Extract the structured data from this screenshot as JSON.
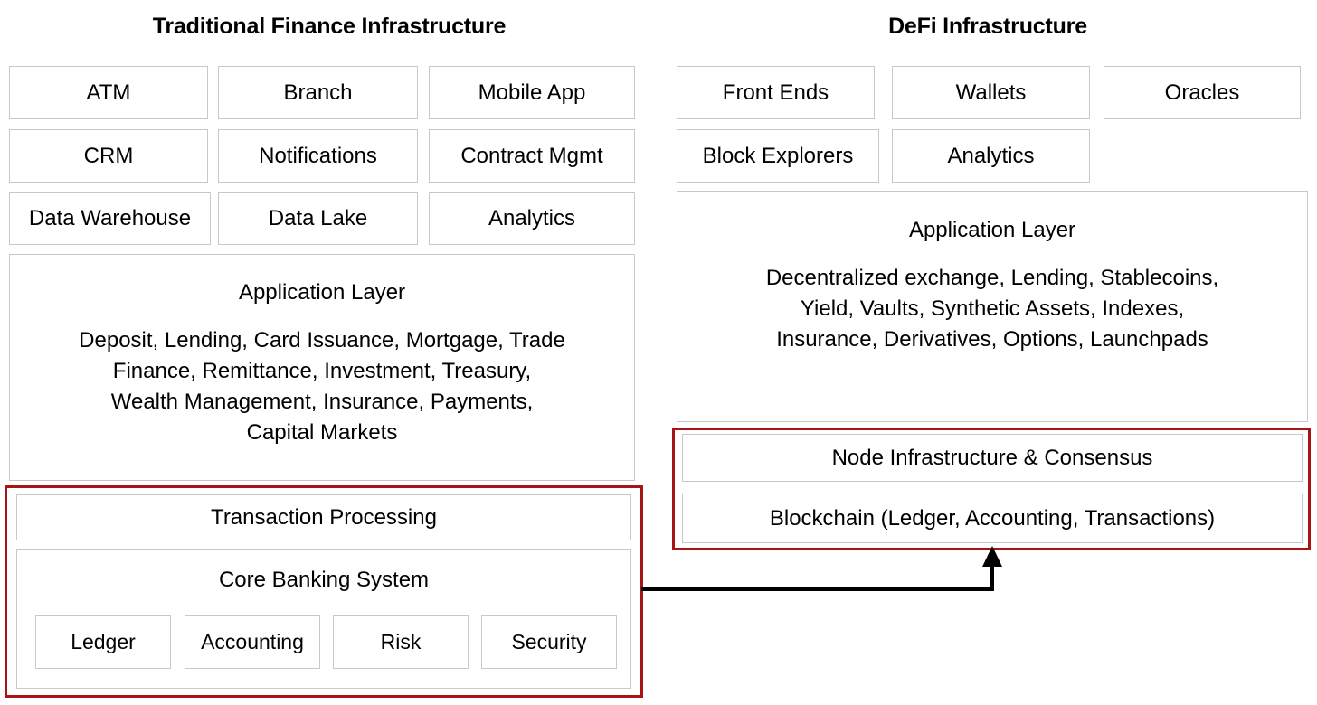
{
  "diagram": {
    "title_left": "Traditional Finance Infrastructure",
    "title_right": "DeFi Infrastructure",
    "accent_red": "#a81414",
    "box_border": "#c8c8c8",
    "arrow_color": "#000000"
  },
  "left": {
    "title": "Traditional Finance Infrastructure",
    "channel_boxes": [
      {
        "label": "ATM"
      },
      {
        "label": "Branch"
      },
      {
        "label": "Mobile App"
      },
      {
        "label": "CRM"
      },
      {
        "label": "Notifications"
      },
      {
        "label": "Contract Mgmt"
      },
      {
        "label": "Data Warehouse"
      },
      {
        "label": "Data Lake"
      },
      {
        "label": "Analytics"
      }
    ],
    "application_layer": {
      "title": "Application Layer",
      "body": "Deposit, Lending, Card Issuance, Mortgage, Trade\nFinance, Remittance, Investment, Treasury,\nWealth Management, Insurance, Payments,\nCapital Markets"
    },
    "highlighted": {
      "transaction_processing": "Transaction Processing",
      "core_banking_title": "Core Banking System",
      "core_banking_modules": [
        {
          "label": "Ledger"
        },
        {
          "label": "Accounting"
        },
        {
          "label": "Risk"
        },
        {
          "label": "Security"
        }
      ]
    }
  },
  "right": {
    "title": "DeFi Infrastructure",
    "channel_boxes": [
      {
        "label": "Front Ends"
      },
      {
        "label": "Wallets"
      },
      {
        "label": "Oracles"
      },
      {
        "label": "Block Explorers"
      },
      {
        "label": "Analytics"
      }
    ],
    "application_layer": {
      "title": "Application Layer",
      "body": "Decentralized exchange, Lending, Stablecoins,\nYield, Vaults, Synthetic Assets, Indexes,\nInsurance, Derivatives, Options, Launchpads"
    },
    "highlighted": {
      "node_infrastructure": "Node Infrastructure & Consensus",
      "blockchain": "Blockchain (Ledger, Accounting, Transactions)"
    }
  }
}
